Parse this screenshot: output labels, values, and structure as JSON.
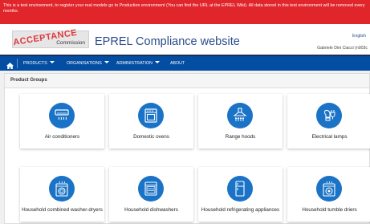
{
  "banner": {
    "text": "This is a test environment, to register your real models go to Production environment (You can find the URL at the EPREL Wiki). All data stored in this test environment will be removed every months."
  },
  "header": {
    "stamp": "ACCEPTANCE",
    "commission": "Commission",
    "title": "EPREL Compliance website",
    "language": "English",
    "user": "Gabriele Dini Ciacci (n003c"
  },
  "nav": {
    "items": [
      {
        "label": "PRODUCTS"
      },
      {
        "label": "ORGANISATIONS"
      },
      {
        "label": "ADMINISTRATION"
      },
      {
        "label": "ABOUT"
      }
    ]
  },
  "panel": {
    "title": "Product Groups"
  },
  "product_groups": [
    {
      "label": "Air conditioners",
      "icon": "air-conditioner-icon"
    },
    {
      "label": "Domestic ovens",
      "icon": "oven-icon"
    },
    {
      "label": "Range hoods",
      "icon": "range-hood-icon"
    },
    {
      "label": "Electrical lamps",
      "icon": "lamp-icon"
    },
    {
      "label": "Household combined washer-dryers",
      "icon": "washer-dryer-icon"
    },
    {
      "label": "Household dishwashers",
      "icon": "dishwasher-icon"
    },
    {
      "label": "Household refrigerating appliances",
      "icon": "refrigerator-icon"
    },
    {
      "label": "Household tumble driers",
      "icon": "tumble-drier-icon"
    }
  ],
  "colors": {
    "banner": "#e0252b",
    "nav": "#034ea2",
    "icon_circle": "#1a73c6",
    "title": "#2b4b8c"
  }
}
